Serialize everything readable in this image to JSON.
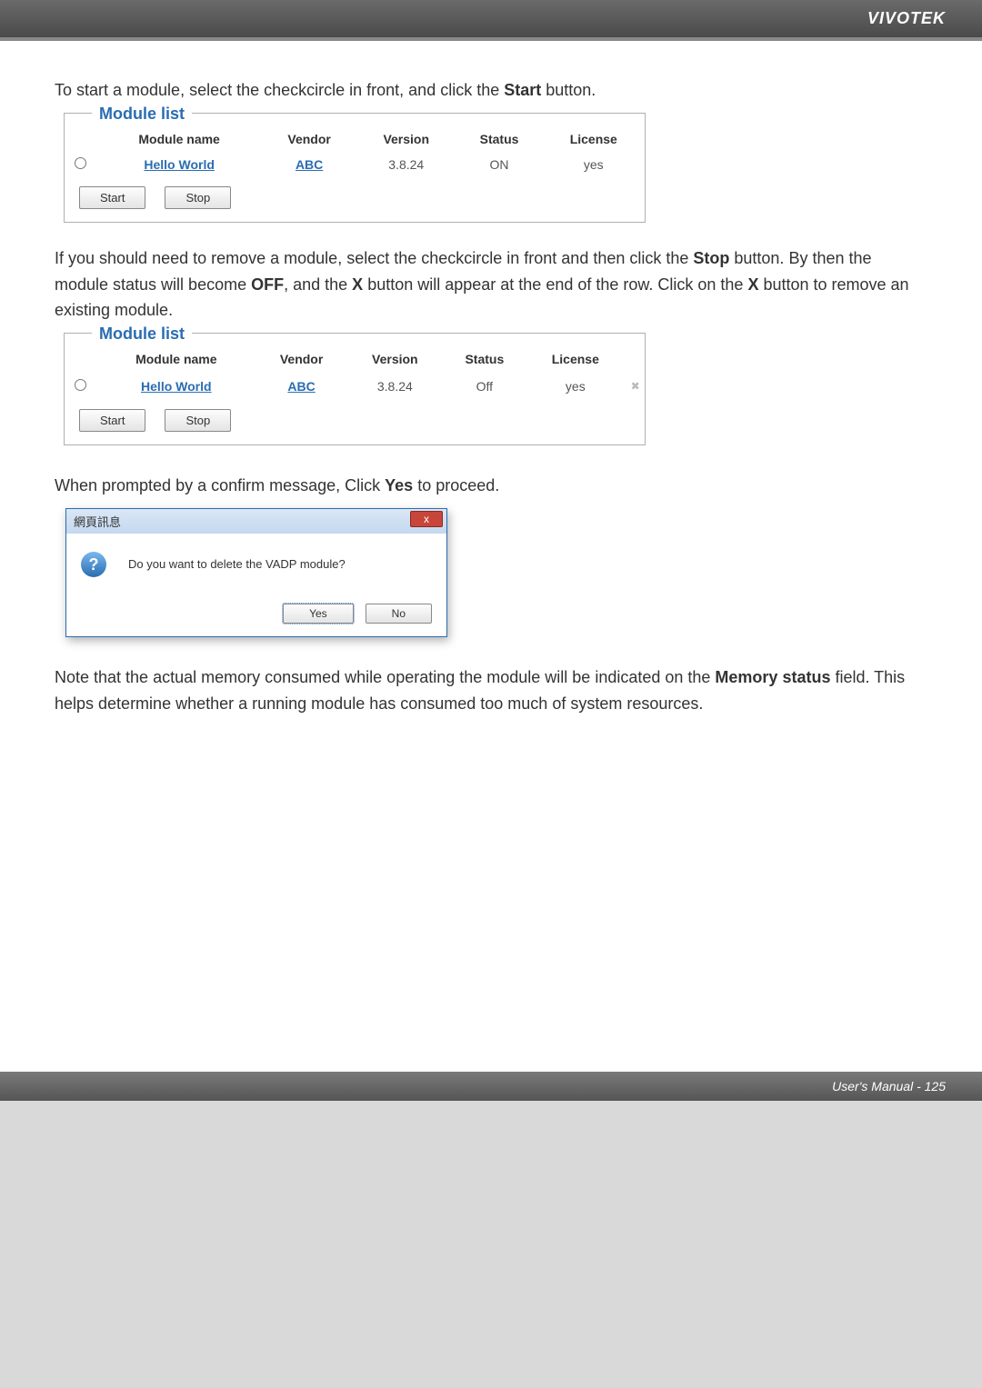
{
  "header": {
    "brand": "VIVOTEK"
  },
  "para1_a": "To start a module, select the checkcircle in front, and click the ",
  "para1_b": "Start",
  "para1_c": " button.",
  "module1": {
    "legend": "Module list",
    "headers": {
      "name": "Module name",
      "vendor": "Vendor",
      "version": "Version",
      "status": "Status",
      "license": "License"
    },
    "row": {
      "name": "Hello World",
      "vendor": "ABC",
      "version": "3.8.24",
      "status": "ON",
      "license": "yes"
    },
    "startLabel": "Start",
    "stopLabel": "Stop"
  },
  "para2_a": "If you should need to remove a module, select the checkcircle in front and then click the ",
  "para2_b": "Stop",
  "para2_c": " button. By then the module status will become ",
  "para2_d": "OFF",
  "para2_e": ", and the ",
  "para2_f": "X",
  "para2_g": " button will appear at the end of the row. Click on the ",
  "para2_h": "X",
  "para2_i": " button to remove an existing module.",
  "module2": {
    "legend": "Module list",
    "headers": {
      "name": "Module name",
      "vendor": "Vendor",
      "version": "Version",
      "status": "Status",
      "license": "License"
    },
    "row": {
      "name": "Hello World",
      "vendor": "ABC",
      "version": "3.8.24",
      "status": "Off",
      "license": "yes"
    },
    "startLabel": "Start",
    "stopLabel": "Stop",
    "deleteIcon": "✖"
  },
  "para3_a": "When prompted by a confirm message, Click ",
  "para3_b": "Yes",
  "para3_c": " to proceed.",
  "dialog": {
    "title": "網頁訊息",
    "close": "x",
    "question": "?",
    "message": "Do you want to delete the VADP module?",
    "yes": "Yes",
    "no": "No"
  },
  "para4_a": "Note that the actual memory consumed while operating the module will be indicated on the ",
  "para4_b": "Memory status",
  "para4_c": " field. This helps determine whether a running module has consumed too much of system resources.",
  "footer": {
    "label": "User's Manual - ",
    "page": "125"
  }
}
